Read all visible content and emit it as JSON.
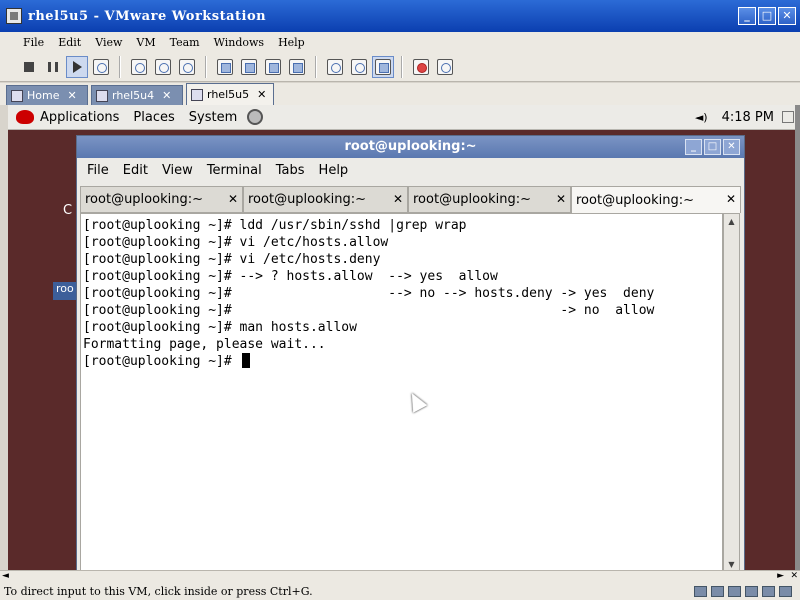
{
  "host": {
    "title": "rhel5u5 - VMware Workstation",
    "window_buttons": [
      "_",
      "□",
      "✕"
    ],
    "menu": [
      "File",
      "Edit",
      "View",
      "VM",
      "Team",
      "Windows",
      "Help"
    ],
    "tabs": [
      {
        "label": "Home",
        "close": "✕"
      },
      {
        "label": "rhel5u4",
        "close": "✕"
      },
      {
        "label": "rhel5u5",
        "close": "✕"
      }
    ],
    "status": "To direct input to this VM, click inside or press Ctrl+G.",
    "hscroll": {
      "left": "◄",
      "right": "►",
      "grip": "✕"
    }
  },
  "guest": {
    "panel": {
      "menus": [
        "Applications",
        "Places",
        "System"
      ],
      "volume": "◄)",
      "clock": "4:18 PM"
    },
    "desktop": {
      "fragment1": "C",
      "fragment2": "roo"
    },
    "terminal": {
      "title": "root@uplooking:~",
      "buttons": [
        "_",
        "□",
        "✕"
      ],
      "menu": [
        "File",
        "Edit",
        "View",
        "Terminal",
        "Tabs",
        "Help"
      ],
      "tabs": [
        {
          "label": "root@uplooking:~",
          "close": "✕"
        },
        {
          "label": "root@uplooking:~",
          "close": "✕"
        },
        {
          "label": "root@uplooking:~",
          "close": "✕"
        },
        {
          "label": "root@uplooking:~",
          "close": "✕"
        }
      ],
      "lines": [
        "[root@uplooking ~]# ldd /usr/sbin/sshd |grep wrap",
        "[root@uplooking ~]# vi /etc/hosts.allow",
        "[root@uplooking ~]# vi /etc/hosts.deny",
        "[root@uplooking ~]# --> ? hosts.allow  --> yes  allow",
        "[root@uplooking ~]#                    --> no --> hosts.deny -> yes  deny",
        "[root@uplooking ~]#                                          -> no  allow",
        "[root@uplooking ~]# man hosts.allow",
        "Formatting page, please wait..."
      ],
      "prompt": "[root@uplooking ~]# ",
      "scroll": {
        "up": "▲",
        "down": "▼"
      }
    }
  }
}
